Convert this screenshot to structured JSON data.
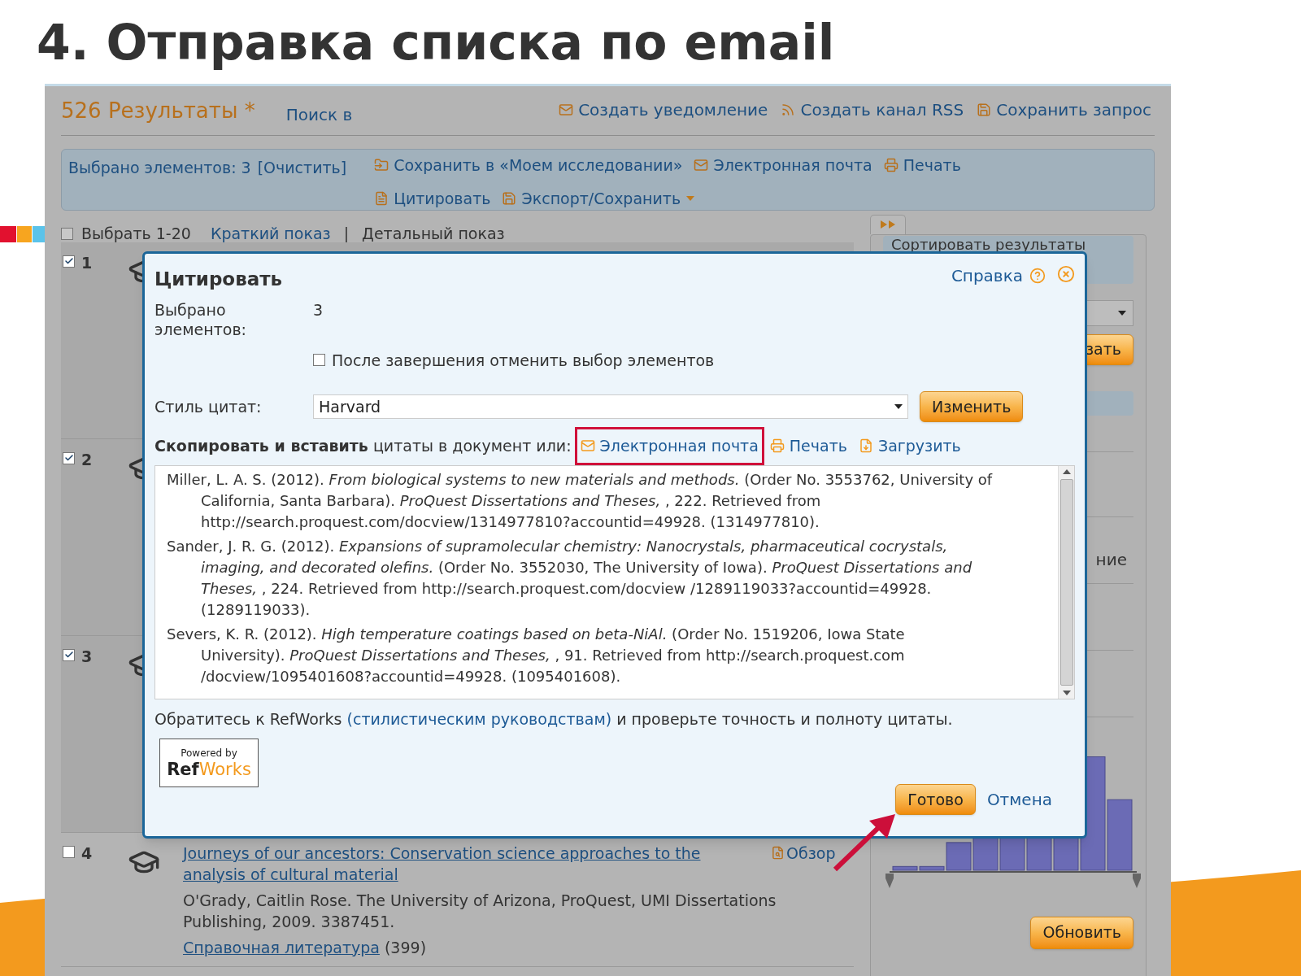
{
  "slide": {
    "title": "4. Отправка списка по email"
  },
  "results_page": {
    "header": {
      "count": "526 Результаты *",
      "search_in": "Поиск в",
      "actions": [
        {
          "kind": "alert",
          "label": "Создать уведомление"
        },
        {
          "kind": "rss",
          "label": "Создать канал RSS"
        },
        {
          "kind": "save",
          "label": "Сохранить запрос"
        }
      ]
    },
    "selection_bar": {
      "selected": "Выбрано элементов: 3",
      "clear": "[Очистить]",
      "actions": [
        {
          "kind": "folder",
          "label": "Сохранить в «Моем исследовании»"
        },
        {
          "kind": "email",
          "label": "Электронная почта"
        },
        {
          "kind": "print",
          "label": "Печать"
        },
        {
          "kind": "cite",
          "label": "Цитировать"
        },
        {
          "kind": "export",
          "label": "Экспорт/Сохранить",
          "dropdown": true
        }
      ]
    },
    "view_bar": {
      "select_all": {
        "label": "Выбрать 1-20",
        "checked": false
      },
      "separator": "|",
      "views": [
        {
          "label": "Краткий показ",
          "selected": false
        },
        {
          "label": "Детальный показ",
          "selected": true
        }
      ]
    },
    "results": [
      {
        "number": "1",
        "checked": true
      },
      {
        "number": "2",
        "checked": true
      },
      {
        "number": "3",
        "checked": true
      },
      {
        "number": "4",
        "checked": false,
        "title": "Journeys of our ancestors: Conservation science approaches to the analysis of cultural material",
        "preview": "Обзор",
        "details": "O'Grady, Caitlin Rose. The University of Arizona, ProQuest, UMI Dissertations Publishing, 2009. 3387451.",
        "references": "Справочная литература",
        "references_count": "(399)"
      }
    ],
    "sidebar": {
      "sort_heading": "Сортировать результаты",
      "sort_button": "зать",
      "facet_text": "ние",
      "update_button": "Обновить"
    }
  },
  "dialog": {
    "title": "Цитировать",
    "help": "Справка",
    "selected_label": "Выбрано элементов:",
    "selected_count": "3",
    "deselect": {
      "label": "После завершения отменить выбор элементов",
      "checked": false
    },
    "style_label": "Стиль цитат:",
    "style_value": "Harvard",
    "change_button": "Изменить",
    "copy_hint": "**Скопировать и вставить** цитаты в документ или:",
    "actions": [
      {
        "kind": "email",
        "label": "Электронная почта",
        "highlighted": true
      },
      {
        "kind": "print",
        "label": "Печать",
        "highlighted": false
      },
      {
        "kind": "download",
        "label": "Загрузить",
        "highlighted": false
      }
    ],
    "citations": [
      "Miller, L. A. S. (2012). *From biological systems to new materials and methods.* (Order No. 3553762, University of California, Santa Barbara). *ProQuest Dissertations and Theses,* , 222. Retrieved from http://search.proquest.com/docview/1314977810?accountid=49928. (1314977810).",
      "Sander, J. R. G. (2012). *Expansions of supramolecular chemistry: Nanocrystals, pharmaceutical cocrystals, imaging, and decorated olefins.* (Order No. 3552030, The University of Iowa). *ProQuest Dissertations and Theses,* , 224. Retrieved from http://search.proquest.com/docview /1289119033?accountid=49928. (1289119033).",
      "Severs, K. R. (2012). *High temperature coatings based on beta-NiAl.* (Order No. 1519206, Iowa State University). *ProQuest Dissertations and Theses,* , 91. Retrieved from http://search.proquest.com /docview/1095401608?accountid=49928. (1095401608)."
    ],
    "note_before": "Обратитесь к RefWorks",
    "note_link": "(стилистическим руководствам)",
    "note_after": "и проверьте точность и полноту цитаты.",
    "logo": {
      "top": "Powered by",
      "brand_a": "Ref",
      "brand_b": "Works"
    },
    "done_button": "Готово",
    "cancel": "Отмена"
  }
}
